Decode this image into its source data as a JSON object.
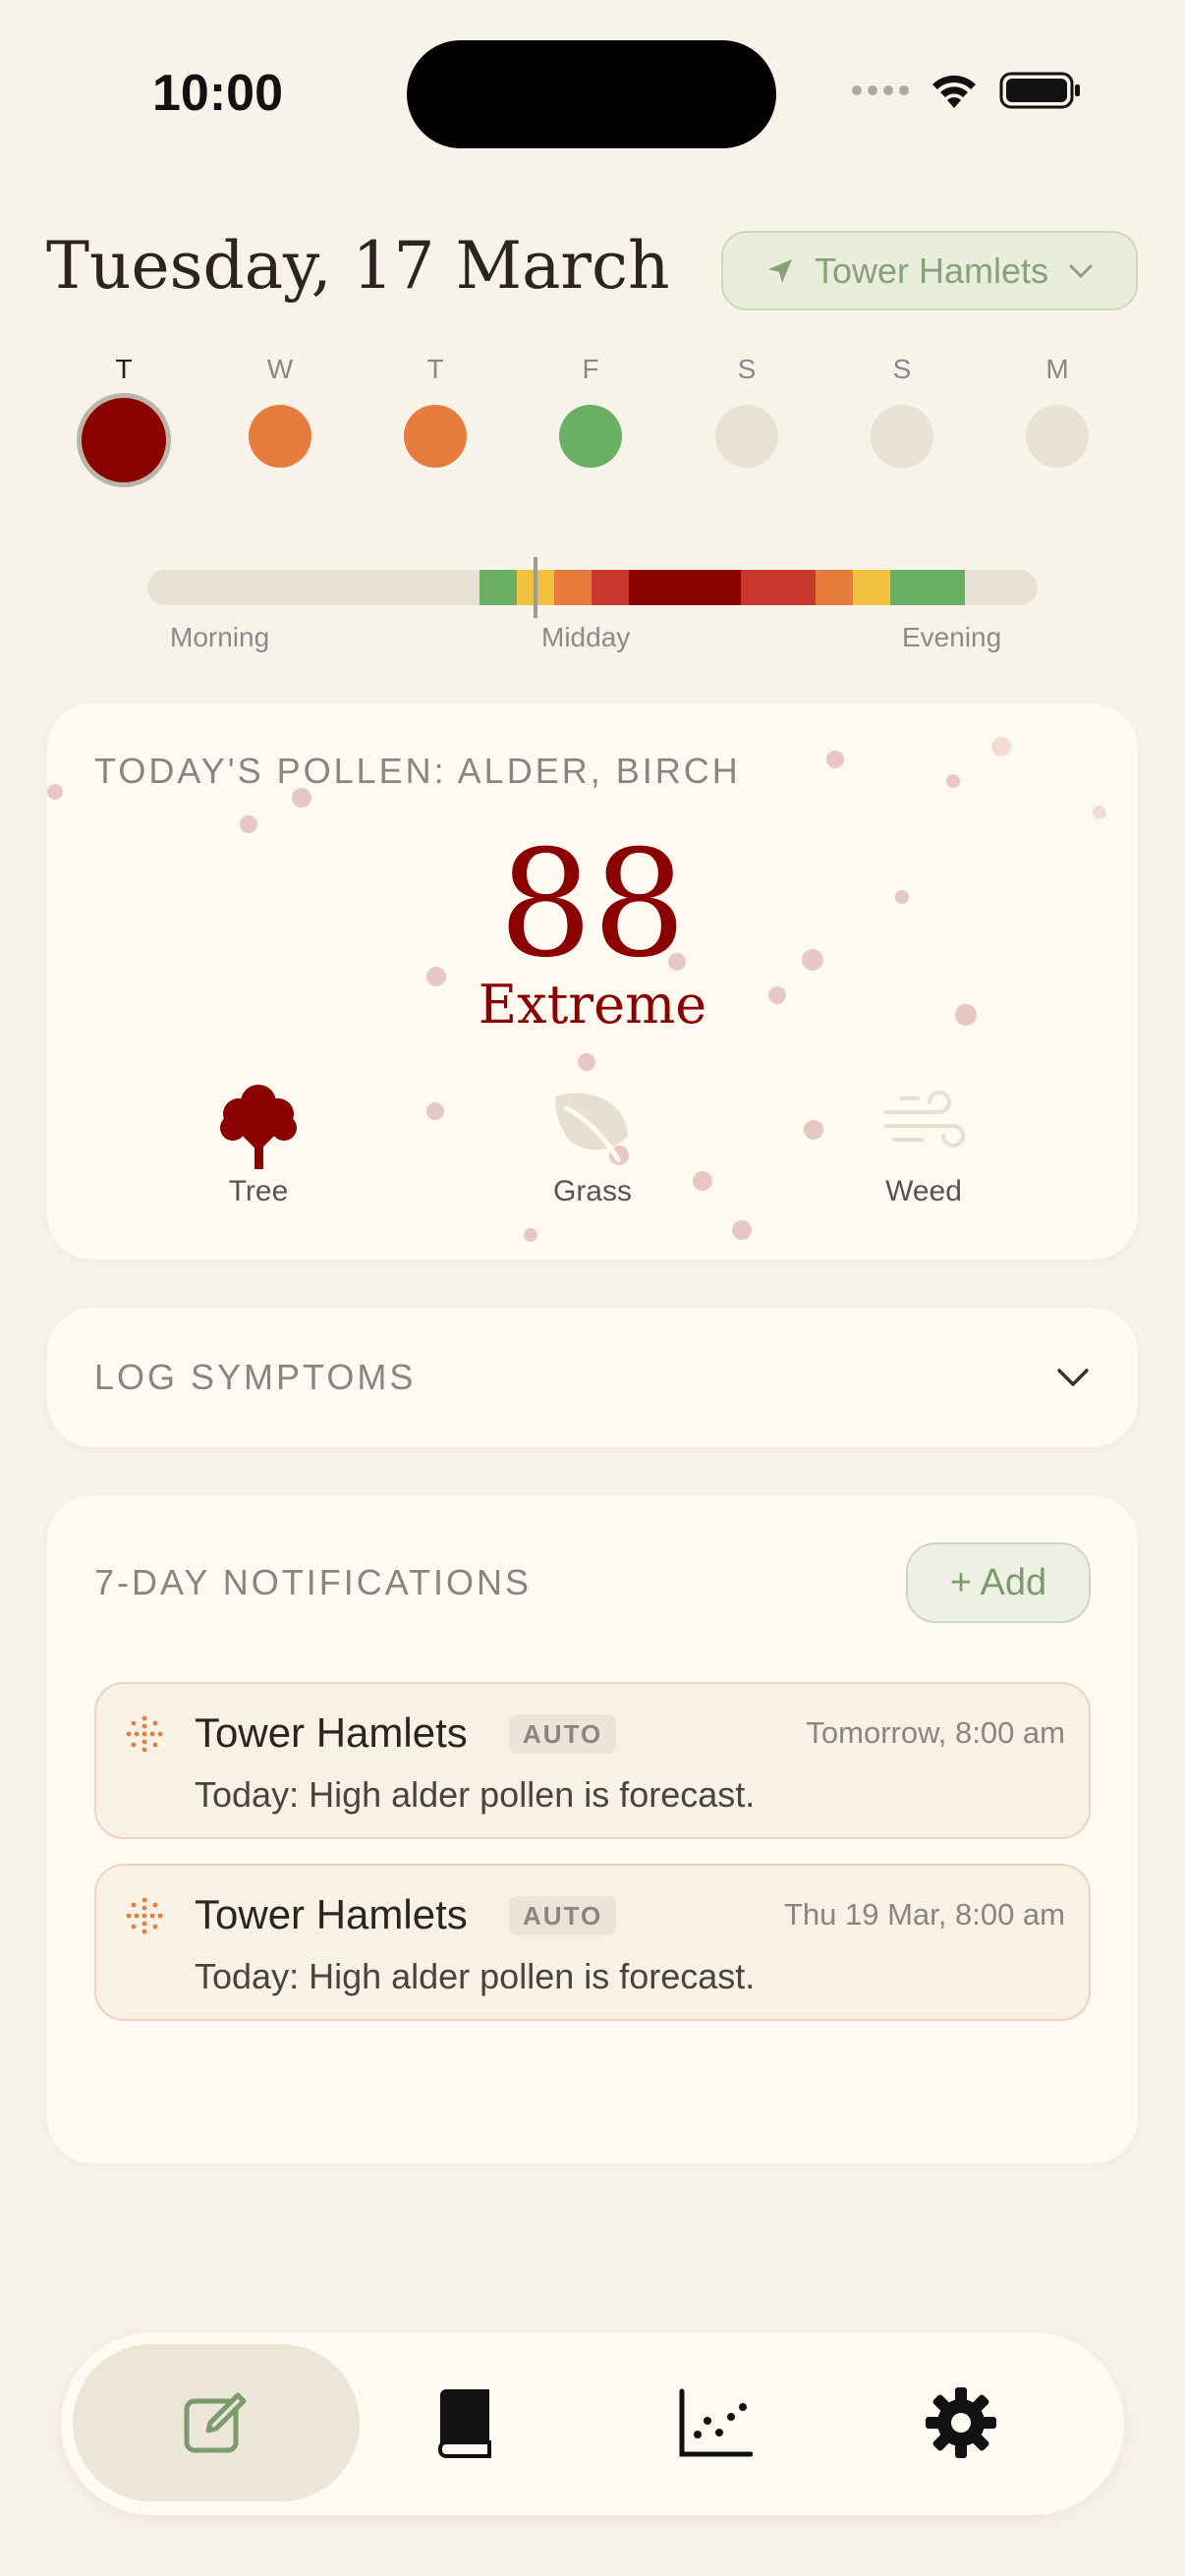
{
  "status_bar": {
    "time": "10:00"
  },
  "header": {
    "date": "Tuesday, 17 March",
    "location": "Tower Hamlets"
  },
  "days": [
    {
      "letter": "T",
      "color": "#8b0000",
      "selected": true
    },
    {
      "letter": "W",
      "color": "#e87c3e",
      "selected": false
    },
    {
      "letter": "T",
      "color": "#e87c3e",
      "selected": false
    },
    {
      "letter": "F",
      "color": "#6aaf63",
      "selected": false
    },
    {
      "letter": "S",
      "color": "#e8e2d6",
      "selected": false
    },
    {
      "letter": "S",
      "color": "#e8e2d6",
      "selected": false
    },
    {
      "letter": "M",
      "color": "#e8e2d6",
      "selected": false
    }
  ],
  "timeline": {
    "labels": [
      "Morning",
      "Midday",
      "Evening"
    ]
  },
  "pollen": {
    "heading": "TODAY'S POLLEN: ALDER, BIRCH",
    "value": "88",
    "level": "Extreme",
    "level_color": "#8b0000",
    "types": [
      {
        "label": "Tree",
        "icon": "tree-icon",
        "active": true
      },
      {
        "label": "Grass",
        "icon": "leaf-icon",
        "active": false
      },
      {
        "label": "Weed",
        "icon": "wind-icon",
        "active": false
      }
    ]
  },
  "log": {
    "heading": "LOG SYMPTOMS"
  },
  "notifications": {
    "heading": "7-DAY NOTIFICATIONS",
    "add_label": "+ Add",
    "items": [
      {
        "title": "Tower Hamlets",
        "badge": "AUTO",
        "time": "Tomorrow, 8:00 am",
        "body": "Today: High alder pollen is forecast."
      },
      {
        "title": "Tower Hamlets",
        "badge": "AUTO",
        "time": "Thu 19 Mar, 8:00 am",
        "body": "Today: High alder pollen is forecast."
      }
    ]
  },
  "tabs": [
    {
      "icon": "compose-icon",
      "active": true
    },
    {
      "icon": "book-icon",
      "active": false
    },
    {
      "icon": "chart-icon",
      "active": false
    },
    {
      "icon": "gear-icon",
      "active": false
    }
  ]
}
